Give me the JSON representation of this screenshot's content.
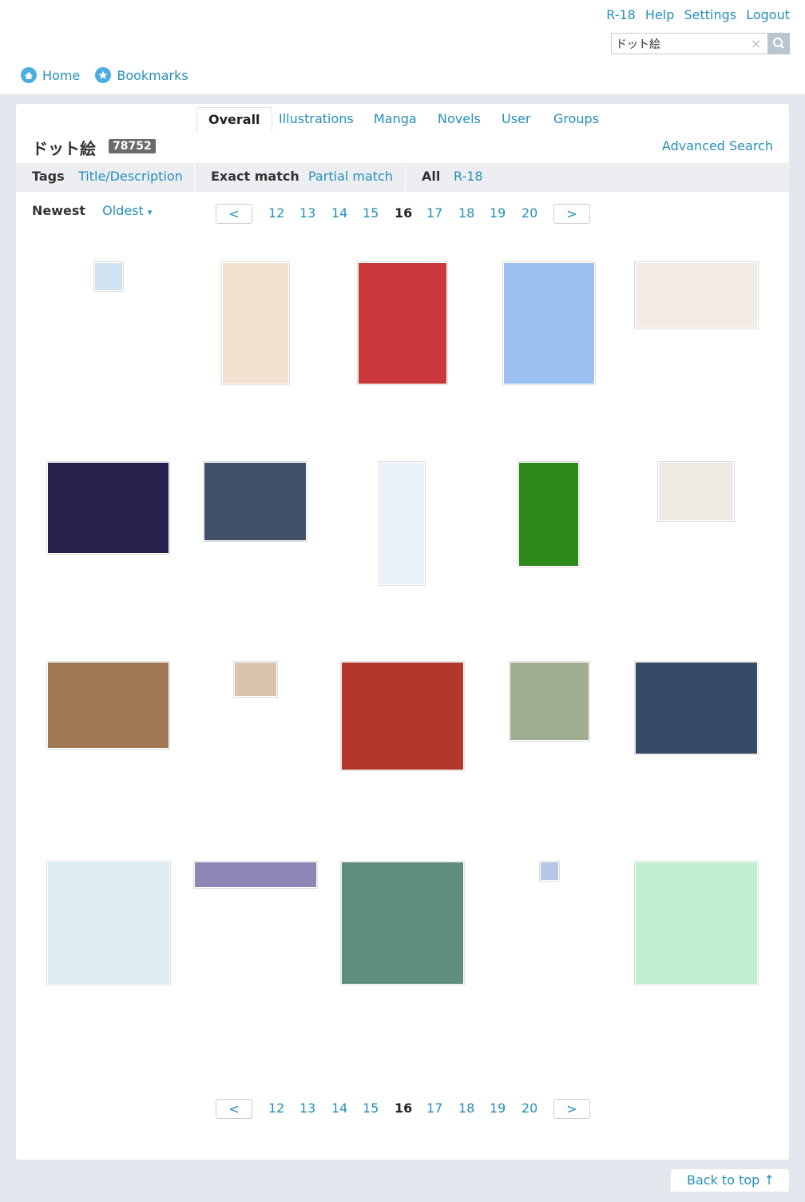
{
  "header": {
    "links": [
      "R-18",
      "Help",
      "Settings",
      "Logout"
    ],
    "search": {
      "value": "ドット絵",
      "clear_icon": "×",
      "button_icon": "search-icon"
    },
    "nav": [
      {
        "label": "Home",
        "icon": "home-icon"
      },
      {
        "label": "Bookmarks",
        "icon": "star-icon"
      }
    ]
  },
  "type_tabs": [
    "Overall",
    "Illustrations",
    "Manga",
    "Novels",
    "User",
    "Groups"
  ],
  "tag": {
    "title": "ドット絵",
    "count": "78752"
  },
  "advanced_search": "Advanced Search",
  "filters": {
    "scope_active": "Tags",
    "scope_other": "Title/Description",
    "match_active": "Exact match",
    "match_other": "Partial match",
    "rating_active": "All",
    "rating_other": "R-18"
  },
  "sort": {
    "active": "Newest",
    "other": "Oldest",
    "arrow": "▾"
  },
  "pager": {
    "prev": "<",
    "next": ">",
    "pages": [
      "12",
      "13",
      "14",
      "15",
      "16",
      "17",
      "18",
      "19",
      "20"
    ],
    "current": "16"
  },
  "thumb_colors": [
    "#cfe3f2",
    "#f0e2cf",
    "#c8373a",
    "#9cc0f2",
    "#f3ebe6",
    "#27224d",
    "#42506b",
    "#e9f0f7",
    "#2e8a1d",
    "#efe9e3",
    "#a07a55",
    "#d9c3ae",
    "#b2382c",
    "#9fac90",
    "#344a66",
    "#dcecf2",
    "#8f86b6",
    "#5e8d80",
    "#b7c6e4",
    "#bfeed0"
  ],
  "back_to_top": "Back to top ↑"
}
